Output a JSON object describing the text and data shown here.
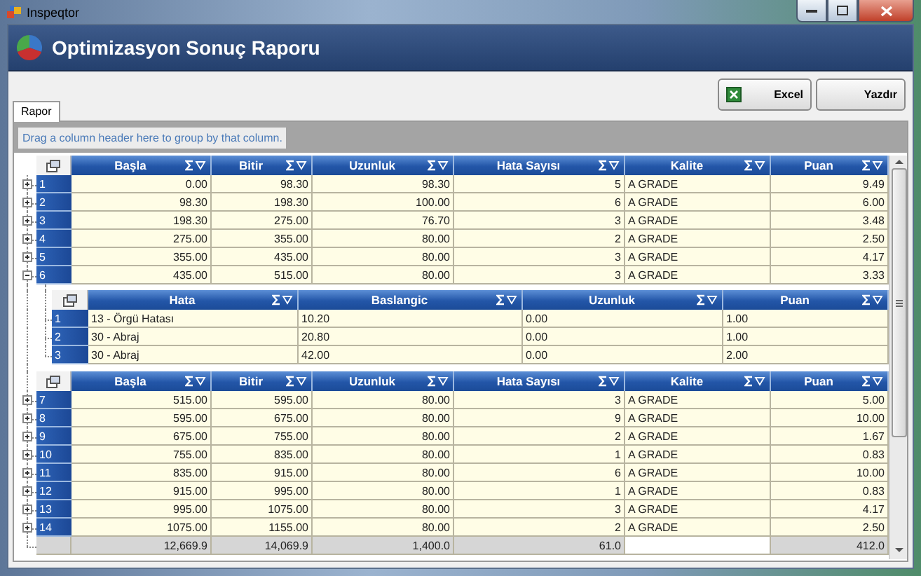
{
  "window": {
    "title": "Inspeqtor"
  },
  "header": {
    "title": "Optimizasyon Sonuç Raporu"
  },
  "toolbar": {
    "buttons": [
      {
        "label": "Excel",
        "kind": "excel"
      },
      {
        "label": "Yazdır",
        "kind": "plain"
      }
    ]
  },
  "tabs": [
    {
      "label": "Rapor",
      "selected": true
    }
  ],
  "group_panel": {
    "hint": "Drag a column header here to group by that column."
  },
  "grid": {
    "sections": [
      {
        "columns": [
          {
            "label": "Başla",
            "kind": "number"
          },
          {
            "label": "Bitir",
            "kind": "number"
          },
          {
            "label": "Uzunluk",
            "kind": "number"
          },
          {
            "label": "Hata Sayısı",
            "kind": "number"
          },
          {
            "label": "Kalite",
            "kind": "text"
          },
          {
            "label": "Puan",
            "kind": "number"
          }
        ],
        "rows": [
          {
            "number": "1",
            "expanded": false,
            "cells": [
              "0.00",
              "98.30",
              "98.30",
              "5",
              "A GRADE",
              "9.49"
            ]
          },
          {
            "number": "2",
            "expanded": false,
            "cells": [
              "98.30",
              "198.30",
              "100.00",
              "6",
              "A GRADE",
              "6.00"
            ]
          },
          {
            "number": "3",
            "expanded": false,
            "cells": [
              "198.30",
              "275.00",
              "76.70",
              "3",
              "A GRADE",
              "3.48"
            ]
          },
          {
            "number": "4",
            "expanded": false,
            "cells": [
              "275.00",
              "355.00",
              "80.00",
              "2",
              "A GRADE",
              "2.50"
            ]
          },
          {
            "number": "5",
            "expanded": false,
            "cells": [
              "355.00",
              "435.00",
              "80.00",
              "3",
              "A GRADE",
              "4.17"
            ]
          },
          {
            "number": "6",
            "expanded": true,
            "cells": [
              "435.00",
              "515.00",
              "80.00",
              "3",
              "A GRADE",
              "3.33"
            ],
            "detail": {
              "columns": [
                {
                  "label": "Hata"
                },
                {
                  "label": "Baslangic"
                },
                {
                  "label": "Uzunluk"
                },
                {
                  "label": "Puan"
                }
              ],
              "rows": [
                {
                  "number": "1",
                  "cells": [
                    "13 - Örgü Hatası",
                    "10.20",
                    "0.00",
                    "1.00"
                  ]
                },
                {
                  "number": "2",
                  "cells": [
                    "30 - Abraj",
                    "20.80",
                    "0.00",
                    "1.00"
                  ]
                },
                {
                  "number": "3",
                  "cells": [
                    "30 - Abraj",
                    "42.00",
                    "0.00",
                    "2.00"
                  ]
                }
              ]
            }
          }
        ]
      },
      {
        "columns": [
          {
            "label": "Başla",
            "kind": "number"
          },
          {
            "label": "Bitir",
            "kind": "number"
          },
          {
            "label": "Uzunluk",
            "kind": "number"
          },
          {
            "label": "Hata Sayısı",
            "kind": "number"
          },
          {
            "label": "Kalite",
            "kind": "text"
          },
          {
            "label": "Puan",
            "kind": "number"
          }
        ],
        "rows": [
          {
            "number": "7",
            "expanded": false,
            "cells": [
              "515.00",
              "595.00",
              "80.00",
              "3",
              "A GRADE",
              "5.00"
            ]
          },
          {
            "number": "8",
            "expanded": false,
            "cells": [
              "595.00",
              "675.00",
              "80.00",
              "9",
              "A GRADE",
              "10.00"
            ]
          },
          {
            "number": "9",
            "expanded": false,
            "cells": [
              "675.00",
              "755.00",
              "80.00",
              "2",
              "A GRADE",
              "1.67"
            ]
          },
          {
            "number": "10",
            "expanded": false,
            "cells": [
              "755.00",
              "835.00",
              "80.00",
              "1",
              "A GRADE",
              "0.83"
            ]
          },
          {
            "number": "11",
            "expanded": false,
            "cells": [
              "835.00",
              "915.00",
              "80.00",
              "6",
              "A GRADE",
              "10.00"
            ]
          },
          {
            "number": "12",
            "expanded": false,
            "cells": [
              "915.00",
              "995.00",
              "80.00",
              "1",
              "A GRADE",
              "0.83"
            ]
          },
          {
            "number": "13",
            "expanded": false,
            "cells": [
              "995.00",
              "1075.00",
              "80.00",
              "3",
              "A GRADE",
              "4.17"
            ]
          },
          {
            "number": "14",
            "expanded": false,
            "cells": [
              "1075.00",
              "1155.00",
              "80.00",
              "2",
              "A GRADE",
              "2.50"
            ]
          }
        ],
        "totals": [
          {
            "kind": "sum",
            "value": "12,669.9"
          },
          {
            "kind": "sum",
            "value": "14,069.9"
          },
          {
            "kind": "sum",
            "value": "1,400.0"
          },
          {
            "kind": "sum",
            "value": "61.0"
          },
          {
            "kind": "empty"
          },
          {
            "kind": "sum",
            "value": "412.0"
          }
        ]
      }
    ]
  }
}
